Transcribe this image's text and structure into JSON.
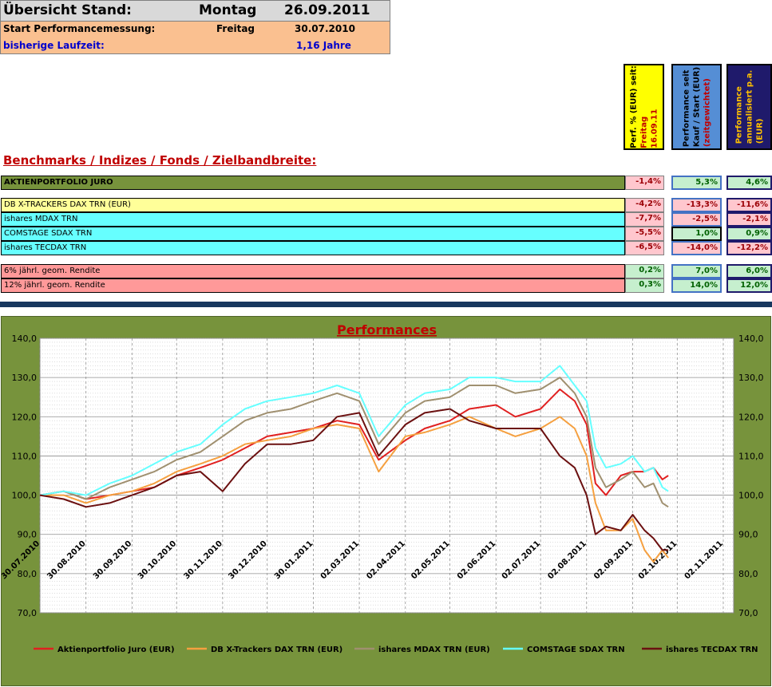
{
  "header": {
    "title": "Übersicht Stand:",
    "weekday": "Montag",
    "date": "26.09.2011",
    "start_label": "Start Performancemessung:",
    "start_weekday": "Freitag",
    "start_date": "30.07.2010",
    "runtime_label": "bisherige Laufzeit:",
    "runtime_value": "1,16 Jahre"
  },
  "column_headers": [
    {
      "line1": "Perf. % (EUR) seit:",
      "line2": "Freitag",
      "line3": "16.09.11",
      "bg": "#ffff00",
      "color1": "#000000",
      "color2": "#c00000"
    },
    {
      "line1": "Performance seit",
      "line2": "Kauf / Start (EUR)",
      "line3": "(zeitgewichtet)",
      "bg": "#558ed5",
      "color1": "#000000",
      "color2": "#c00000"
    },
    {
      "line1": "Performance",
      "line2": "annualisiert p.a.",
      "line3": "(EUR)",
      "bg": "#1f1a6b",
      "color1": "#ffc000",
      "color2": "#ffc000"
    }
  ],
  "benchmarks_title": "Benchmarks / Indizes / Fonds / Zielbandbreite:",
  "rows": [
    {
      "name": "AKTIENPORTFOLIO JURO",
      "bg": "#77933c",
      "bold": true,
      "c1": "-1,4%",
      "c2": "5,3%",
      "c3": "4,6%",
      "g": 0
    },
    {
      "name": "DB X-TRACKERS DAX TRN (EUR)",
      "bg": "#ffff99",
      "bold": false,
      "c1": "-4,2%",
      "c2": "-13,3%",
      "c3": "-11,6%",
      "g": 1
    },
    {
      "name": "ishares MDAX TRN",
      "bg": "#66ffff",
      "bold": false,
      "c1": "-7,7%",
      "c2": "-2,5%",
      "c3": "-2,1%",
      "g": 1
    },
    {
      "name": "COMSTAGE SDAX TRN",
      "bg": "#66ffff",
      "bold": false,
      "c1": "-5,5%",
      "c2": "1,0%",
      "c3": "0,9%",
      "g": 1
    },
    {
      "name": "ishares TECDAX TRN",
      "bg": "#66ffff",
      "bold": false,
      "c1": "-6,5%",
      "c2": "-14,0%",
      "c3": "-12,2%",
      "g": 1
    },
    {
      "name": "6% jährl. geom. Rendite",
      "bg": "#ff9999",
      "bold": false,
      "c1": "0,2%",
      "c2": "7,0%",
      "c3": "6,0%",
      "g": 2
    },
    {
      "name": "12% jährl. geom. Rendite",
      "bg": "#ff9999",
      "bold": false,
      "c1": "0,3%",
      "c2": "14,0%",
      "c3": "12,0%",
      "g": 2
    }
  ],
  "colors": {
    "negative_bg": "#ffc7ce",
    "negative_fg": "#9c0006",
    "positive_bg": "#c6efce",
    "positive_fg": "#006100",
    "box_blue": "#4472c4",
    "box_navy": "#1f1a6b"
  },
  "chart_data": {
    "type": "line",
    "title": "Performances",
    "xlabel": "",
    "ylabel": "",
    "ylim": [
      70,
      140
    ],
    "yticks": [
      "70,0",
      "80,0",
      "90,0",
      "100,0",
      "110,0",
      "120,0",
      "130,0",
      "140,0"
    ],
    "y2ticks": [
      "70,0",
      "80,0",
      "90,0",
      "100,0",
      "110,0",
      "120,0",
      "130,0",
      "140,0"
    ],
    "xlim": [
      "30.07.2010",
      "09.11.2011"
    ],
    "xticks": [
      "30.07.2010",
      "30.08.2010",
      "30.09.2010",
      "30.10.2010",
      "30.11.2010",
      "30.12.2010",
      "30.01.2011",
      "02.03.2011",
      "02.04.2011",
      "02.05.2011",
      "02.06.2011",
      "02.07.2011",
      "02.08.2011",
      "02.09.2011",
      "02.10.2011",
      "02.11.2011"
    ],
    "grid": true,
    "legend": "bottom",
    "x": [
      "30.07.2010",
      "15.08.2010",
      "30.08.2010",
      "15.09.2010",
      "30.09.2010",
      "15.10.2010",
      "30.10.2010",
      "15.11.2010",
      "30.11.2010",
      "15.12.2010",
      "30.12.2010",
      "15.01.2011",
      "30.01.2011",
      "15.02.2011",
      "02.03.2011",
      "15.03.2011",
      "02.04.2011",
      "15.04.2011",
      "02.05.2011",
      "15.05.2011",
      "02.06.2011",
      "15.06.2011",
      "02.07.2011",
      "15.07.2011",
      "25.07.2011",
      "02.08.2011",
      "08.08.2011",
      "15.08.2011",
      "25.08.2011",
      "02.09.2011",
      "10.09.2011",
      "16.09.2011",
      "22.09.2011",
      "26.09.2011"
    ],
    "series": [
      {
        "name": "Aktienportfolio Juro (EUR)",
        "color": "#e02020",
        "values": [
          100,
          101,
          99,
          100,
          101,
          102,
          105,
          107,
          109,
          112,
          115,
          116,
          117,
          119,
          118,
          109,
          114,
          117,
          119,
          122,
          123,
          120,
          122,
          127,
          124,
          118,
          103,
          100,
          105,
          106,
          106,
          107,
          104,
          105
        ]
      },
      {
        "name": "DB X-Trackers DAX TRN (EUR)",
        "color": "#f5a040",
        "values": [
          100,
          100,
          98,
          100,
          101,
          103,
          106,
          108,
          110,
          113,
          114,
          115,
          117,
          118,
          117,
          106,
          115,
          116,
          118,
          120,
          117,
          115,
          117,
          120,
          117,
          110,
          98,
          91,
          91,
          94,
          86,
          83,
          86,
          84
        ]
      },
      {
        "name": "ishares MDAX TRN (EUR)",
        "color": "#a09070",
        "values": [
          100,
          101,
          99,
          102,
          104,
          106,
          109,
          111,
          115,
          119,
          121,
          122,
          124,
          126,
          124,
          113,
          121,
          124,
          125,
          128,
          128,
          126,
          127,
          130,
          126,
          120,
          107,
          102,
          104,
          106,
          102,
          103,
          98,
          97
        ]
      },
      {
        "name": "COMSTAGE SDAX TRN",
        "color": "#66ffff",
        "values": [
          100,
          101,
          100,
          103,
          105,
          108,
          111,
          113,
          118,
          122,
          124,
          125,
          126,
          128,
          126,
          115,
          123,
          126,
          127,
          130,
          130,
          129,
          129,
          133,
          128,
          124,
          112,
          107,
          108,
          110,
          106,
          107,
          102,
          101
        ]
      },
      {
        "name": "ishares TECDAX TRN",
        "color": "#6b1010",
        "values": [
          100,
          99,
          97,
          98,
          100,
          102,
          105,
          106,
          101,
          108,
          113,
          113,
          114,
          120,
          121,
          110,
          118,
          121,
          122,
          119,
          117,
          117,
          117,
          110,
          107,
          100,
          90,
          92,
          91,
          95,
          91,
          89,
          86,
          86
        ]
      }
    ]
  }
}
